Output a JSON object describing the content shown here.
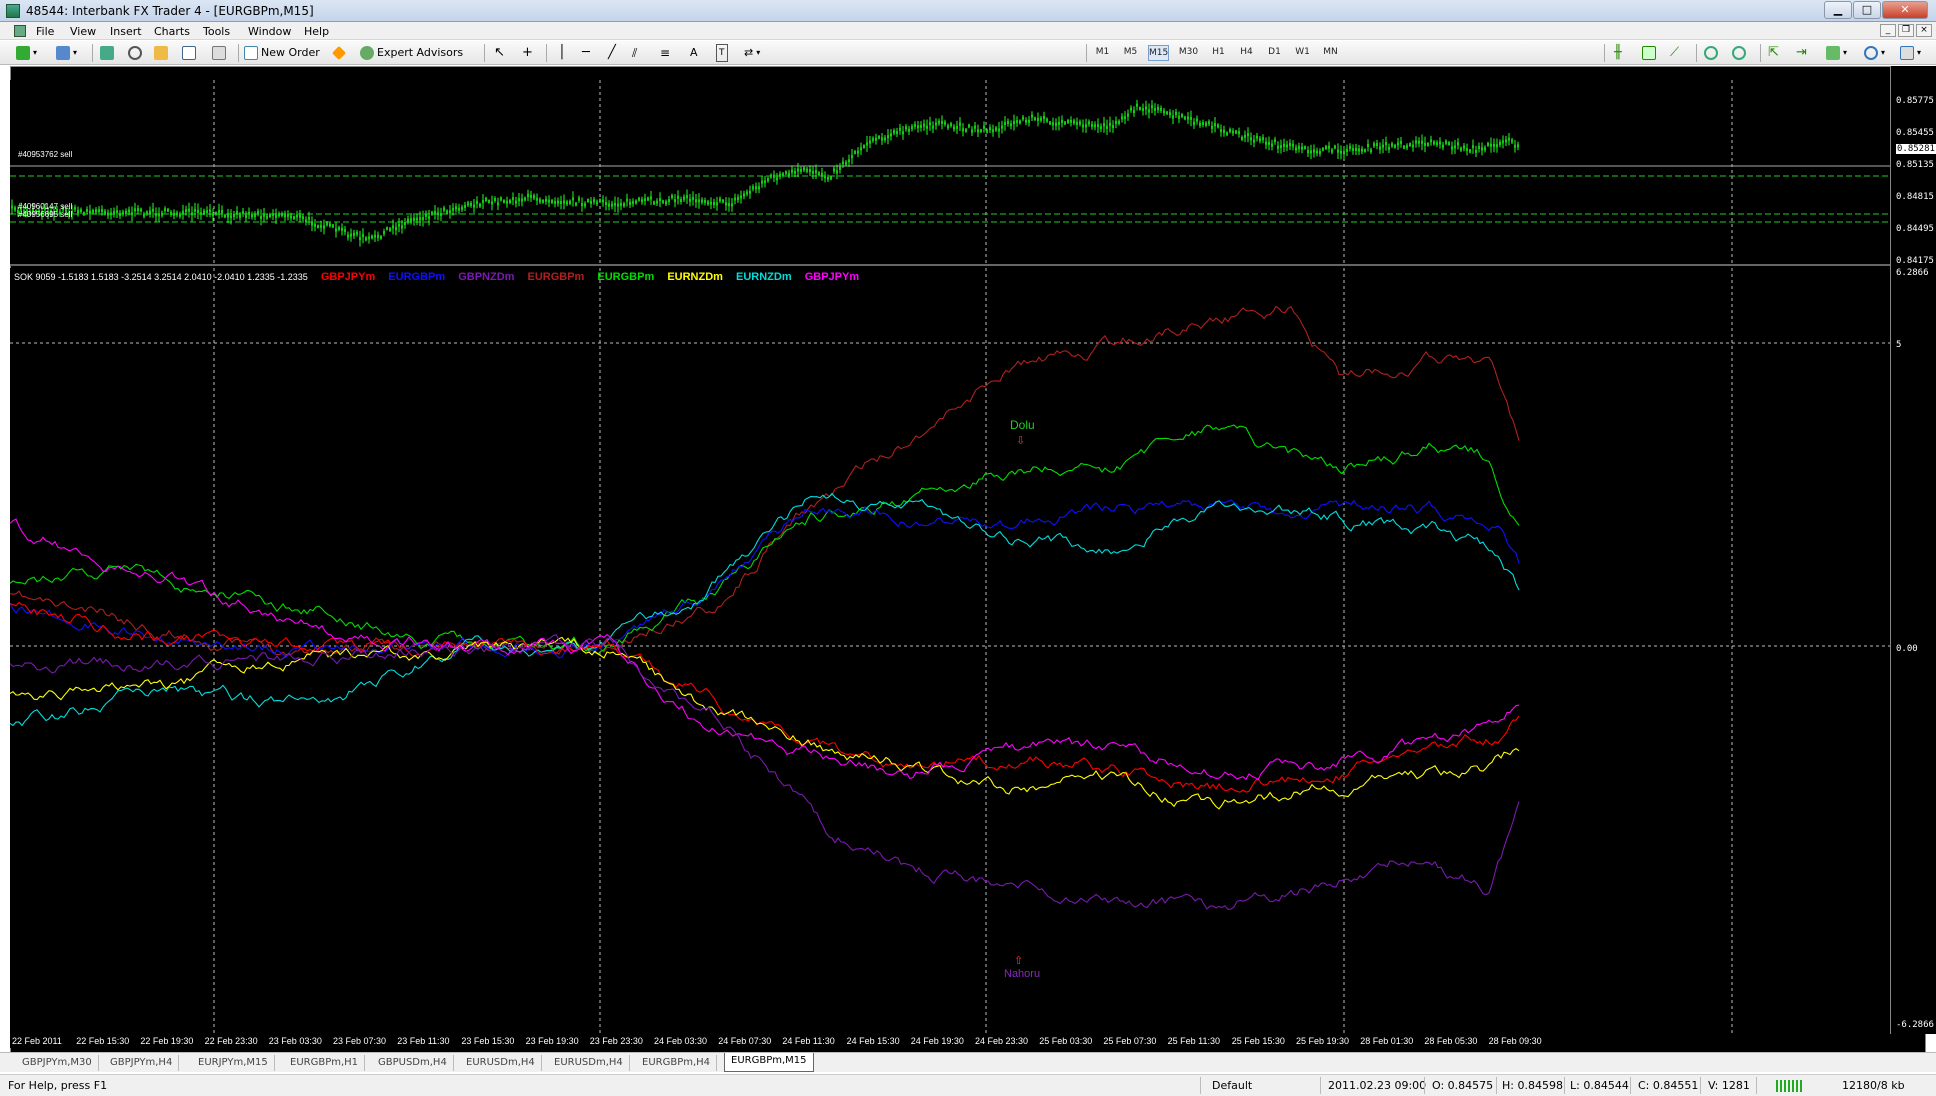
{
  "window": {
    "title": "48544: Interbank FX Trader 4 - [EURGBPm,M15]"
  },
  "menu": [
    "File",
    "View",
    "Insert",
    "Charts",
    "Tools",
    "Window",
    "Help"
  ],
  "toolbar": {
    "new_order": "New Order",
    "expert_advisors": "Expert Advisors",
    "text_tool": "A",
    "timeframes": [
      "M1",
      "M5",
      "M15",
      "M30",
      "H1",
      "H4",
      "D1",
      "W1",
      "MN"
    ],
    "active_timeframe": "M15"
  },
  "price_axis": [
    "0.85775",
    "0.85455",
    "0.85281",
    "0.85135",
    "0.84815",
    "0.84495",
    "0.84175"
  ],
  "current_price": "0.85281",
  "orders": [
    "#40953762 sell",
    "#40960147 sell",
    "#40956695 sell"
  ],
  "indicator": {
    "header": "SOK 9059 -1.5183 1.5183 -3.2514 3.2514 2.0410 -2.0410 1.2335 -1.2335",
    "legend": [
      {
        "name": "GBPJPYm",
        "color": "#ff0000"
      },
      {
        "name": "EURGBPm",
        "color": "#1010ff"
      },
      {
        "name": "GBPNZDm",
        "color": "#7a1ab0"
      },
      {
        "name": "EURGBPm",
        "color": "#b02020"
      },
      {
        "name": "EURGBPm",
        "color": "#00dd00"
      },
      {
        "name": "EURNZDm",
        "color": "#ffff00"
      },
      {
        "name": "EURNZDm",
        "color": "#00dddd"
      },
      {
        "name": "GBPJPYm",
        "color": "#ff00ff"
      }
    ],
    "axis": [
      "6.2866",
      "5",
      "0.00",
      "-6.2866"
    ],
    "dolu": "Dolu",
    "nahoru": "Nahoru"
  },
  "time_axis": [
    "22 Feb 2011",
    "22 Feb 15:30",
    "22 Feb 19:30",
    "22 Feb 23:30",
    "23 Feb 03:30",
    "23 Feb 07:30",
    "23 Feb 11:30",
    "23 Feb 15:30",
    "23 Feb 19:30",
    "23 Feb 23:30",
    "24 Feb 03:30",
    "24 Feb 07:30",
    "24 Feb 11:30",
    "24 Feb 15:30",
    "24 Feb 19:30",
    "24 Feb 23:30",
    "25 Feb 03:30",
    "25 Feb 07:30",
    "25 Feb 11:30",
    "25 Feb 15:30",
    "25 Feb 19:30",
    "28 Feb 01:30",
    "28 Feb 05:30",
    "28 Feb 09:30"
  ],
  "tabs": [
    "GBPJPYm,M30",
    "GBPJPYm,H4",
    "EURJPYm,M15",
    "EURGBPm,H1",
    "GBPUSDm,H4",
    "EURUSDm,H4",
    "EURUSDm,H4",
    "EURGBPm,H4",
    "EURGBPm,M15"
  ],
  "active_tab": 8,
  "status": {
    "help": "For Help, press F1",
    "profile": "Default",
    "time": "2011.02.23 09:00",
    "open": "O: 0.84575",
    "high": "H: 0.84598",
    "low": "L: 0.84544",
    "close": "C: 0.84551",
    "volume": "V: 1281",
    "traffic": "12180/8 kb"
  }
}
